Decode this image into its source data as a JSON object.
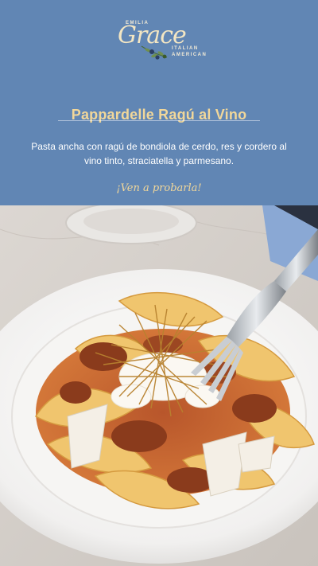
{
  "brand": {
    "top_text": "EMILIA",
    "script_text": "Grace",
    "line1": "ITALIAN",
    "line2": "AMERICAN"
  },
  "dish": {
    "title": "Pappardelle Ragú al Vino",
    "description": "Pasta ancha con ragú de bondiola de cerdo, res y cordero al vino tinto, straciatella y parmesano.",
    "cta": "¡Ven a probarla!"
  },
  "colors": {
    "panel_bg": "#6186b4",
    "title_gold": "#f1d79a",
    "text_white": "#ffffff"
  }
}
